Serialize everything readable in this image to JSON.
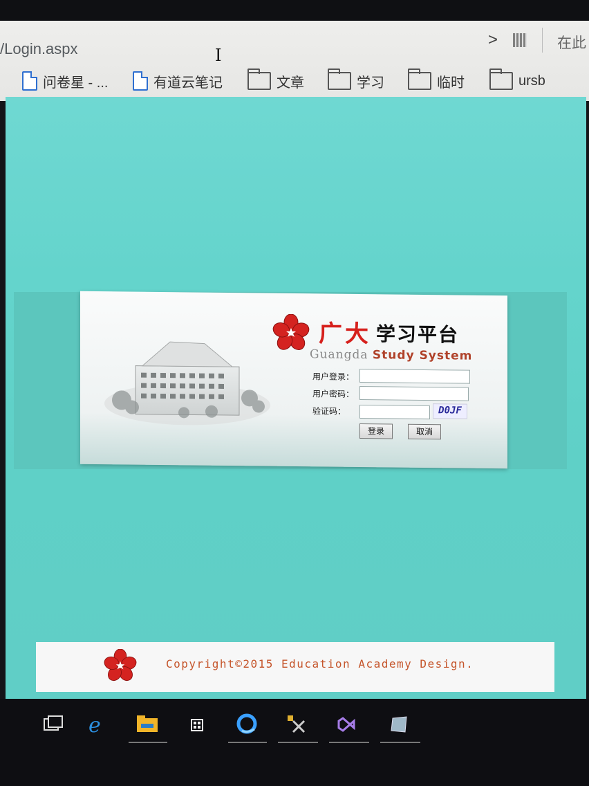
{
  "browser": {
    "address_text": "/Login.aspx",
    "search_hint": "在此",
    "bookmarks": [
      {
        "label": "问卷星 - ...",
        "icon": "document-icon"
      },
      {
        "label": "有道云笔记",
        "icon": "document-icon"
      },
      {
        "label": "文章",
        "icon": "folder-icon"
      },
      {
        "label": "学习",
        "icon": "folder-icon"
      },
      {
        "label": "临时",
        "icon": "folder-icon"
      },
      {
        "label": "ursb",
        "icon": "folder-icon"
      }
    ]
  },
  "login": {
    "title_cn_brand": "广大",
    "title_cn_rest": "学习平台",
    "subtitle_en_1": "Guangda",
    "subtitle_en_2": "Study System",
    "username_label": "用户登录：",
    "password_label": "用户密码：",
    "captcha_label": "验证码：",
    "captcha_text": "D0JF",
    "login_button": "登录",
    "cancel_button": "取消"
  },
  "footer": {
    "copyright": "Copyright©2015 Education Academy Design."
  },
  "colors": {
    "page_background": "#64d4cc",
    "brand_red": "#d6201c",
    "copyright_text": "#c5552b"
  },
  "taskbar": {
    "icons": [
      "task-view-icon",
      "edge-browser-icon",
      "file-explorer-icon",
      "store-icon",
      "qq-browser-icon",
      "tools-icon",
      "visual-studio-icon",
      "app-icon"
    ]
  }
}
